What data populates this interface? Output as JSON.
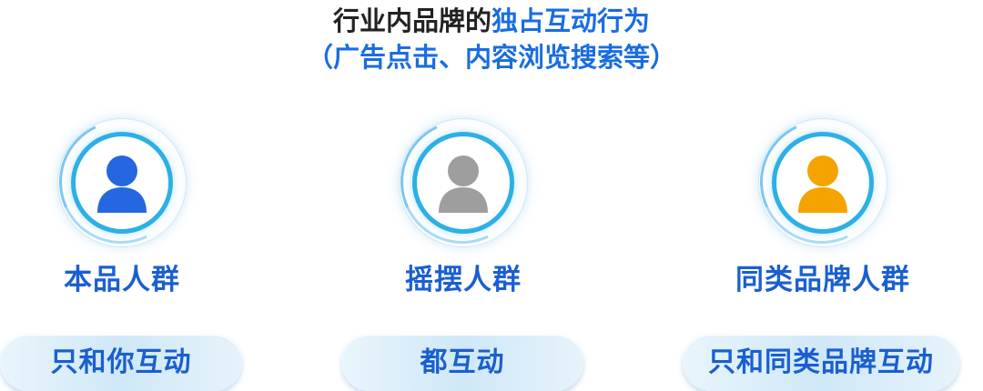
{
  "header": {
    "title_prefix": "行业内品牌的",
    "title_highlight": "独占互动行为",
    "subtitle": "（广告点击、内容浏览搜索等）"
  },
  "colors": {
    "accent": "#1a6de0",
    "ring": "#2cb0e6",
    "own_brand": "#2467e0",
    "swing": "#9e9e9e",
    "same_category": "#f5a300"
  },
  "groups": [
    {
      "label": "本品人群",
      "behavior": "只和你互动",
      "icon": "person-icon",
      "color": "#2467e0"
    },
    {
      "label": "摇摆人群",
      "behavior": "都互动",
      "icon": "person-icon",
      "color": "#9e9e9e"
    },
    {
      "label": "同类品牌人群",
      "behavior": "只和同类品牌互动",
      "icon": "person-icon",
      "color": "#f5a300"
    }
  ]
}
